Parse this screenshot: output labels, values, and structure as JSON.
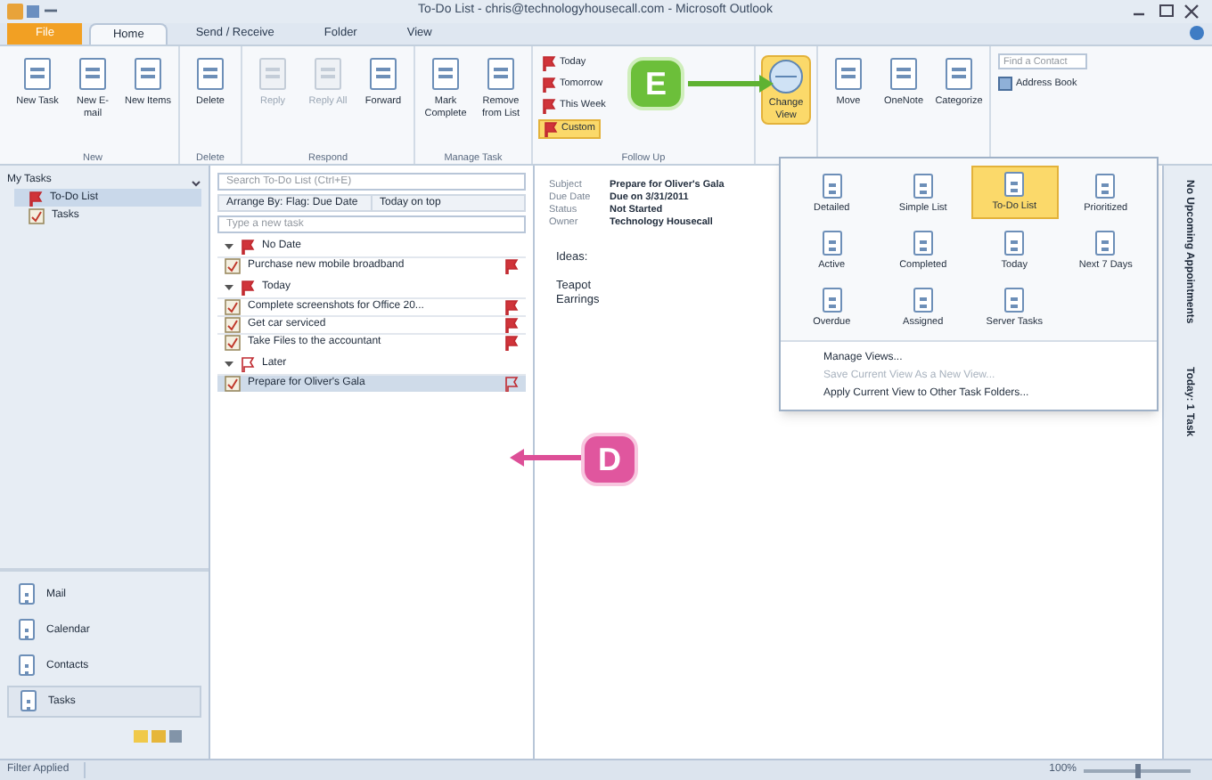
{
  "window": {
    "title": "To-Do List - chris@technologyhousecall.com - Microsoft Outlook"
  },
  "tabs": [
    {
      "label": "File",
      "selected": false,
      "kind": "file"
    },
    {
      "label": "Home",
      "selected": true,
      "kind": "tab"
    },
    {
      "label": "Send / Receive",
      "selected": false,
      "kind": "tab"
    },
    {
      "label": "Folder",
      "selected": false,
      "kind": "tab"
    },
    {
      "label": "View",
      "selected": false,
      "kind": "tab"
    }
  ],
  "ribbon": {
    "groups": [
      {
        "label": "New",
        "buttons": [
          {
            "label": "New Task",
            "disabled": false
          },
          {
            "label": "New E-mail",
            "disabled": false
          },
          {
            "label": "New Items",
            "disabled": false
          }
        ]
      },
      {
        "label": "Delete",
        "buttons": [
          {
            "label": "Delete",
            "disabled": false
          }
        ]
      },
      {
        "label": "Respond",
        "buttons": [
          {
            "label": "Reply",
            "disabled": true
          },
          {
            "label": "Reply All",
            "disabled": true
          },
          {
            "label": "Forward",
            "disabled": false
          }
        ]
      },
      {
        "label": "Manage Task",
        "buttons": [
          {
            "label": "Mark Complete",
            "disabled": false
          },
          {
            "label": "Remove from List",
            "disabled": false
          }
        ]
      },
      {
        "label": "Follow Up",
        "flags": [
          {
            "label": "Today",
            "selected": false
          },
          {
            "label": "Tomorrow",
            "selected": false
          },
          {
            "label": "This Week",
            "selected": false
          },
          {
            "label": "Custom",
            "selected": true
          }
        ]
      },
      {
        "buttons": [
          {
            "label": "Change View",
            "disabled": false
          }
        ]
      },
      {
        "buttons": [
          {
            "label": "Move",
            "disabled": false
          },
          {
            "label": "OneNote",
            "disabled": false
          },
          {
            "label": "Categorize",
            "disabled": false
          }
        ]
      }
    ],
    "find_contact": {
      "placeholder": "Find a Contact"
    },
    "address_book": "Address Book"
  },
  "nav": {
    "header": "My Tasks",
    "folders": [
      {
        "label": "To-Do List",
        "selected": true
      },
      {
        "label": "Tasks",
        "selected": false
      }
    ],
    "modules": [
      {
        "label": "Mail",
        "selected": false
      },
      {
        "label": "Calendar",
        "selected": false
      },
      {
        "label": "Contacts",
        "selected": false
      },
      {
        "label": "Tasks",
        "selected": true
      }
    ]
  },
  "task_list": {
    "search": {
      "placeholder": "Search To-Do List (Ctrl+E)"
    },
    "arrange_by": "Arrange By: Flag: Due Date",
    "order": "Today on top",
    "new_task": {
      "placeholder": "Type a new task"
    },
    "groups": [
      {
        "label": "No Date",
        "flagged": true,
        "tasks": [
          {
            "title": "Purchase new mobile broadband",
            "selected": false
          }
        ]
      },
      {
        "label": "Today",
        "flagged": true,
        "tasks": [
          {
            "title": "Complete screenshots for Office 20...",
            "selected": false
          },
          {
            "title": "Get car serviced",
            "selected": false
          },
          {
            "title": "Take Files to the accountant",
            "selected": false
          }
        ]
      },
      {
        "label": "Later",
        "flagged": false,
        "tasks": [
          {
            "title": "Prepare for Oliver's Gala",
            "selected": true
          }
        ]
      }
    ]
  },
  "reading_pane": {
    "fields": [
      {
        "label": "Subject",
        "value": "Prepare for Oliver's Gala"
      },
      {
        "label": "Due Date",
        "value": "Due on 3/31/2011"
      },
      {
        "label": "Status",
        "value": "Not Started"
      },
      {
        "label": "Owner",
        "value": "Technology Housecall"
      }
    ],
    "body": [
      {
        "lines": [
          "Ideas:"
        ]
      },
      {
        "lines": [
          "Teapot",
          "Earrings"
        ]
      }
    ]
  },
  "view_gallery": {
    "views": [
      {
        "label": "Detailed",
        "selected": false
      },
      {
        "label": "Simple List",
        "selected": false
      },
      {
        "label": "To-Do List",
        "selected": true
      },
      {
        "label": "Prioritized",
        "selected": false
      },
      {
        "label": "Active",
        "selected": false
      },
      {
        "label": "Completed",
        "selected": false
      },
      {
        "label": "Today",
        "selected": false
      },
      {
        "label": "Next 7 Days",
        "selected": false
      },
      {
        "label": "Overdue",
        "selected": false
      },
      {
        "label": "Assigned",
        "selected": false
      },
      {
        "label": "Server Tasks",
        "selected": false
      }
    ],
    "commands": [
      {
        "label": "Manage Views...",
        "disabled": false
      },
      {
        "label": "Save Current View As a New View...",
        "disabled": true
      },
      {
        "label": "Apply Current View to Other Task Folders...",
        "disabled": false
      }
    ]
  },
  "todo_bar": {
    "sections": [
      "No Upcoming Appointments",
      "Today: 1 Task"
    ]
  },
  "status_bar": {
    "left": "Filter Applied",
    "zoom": "100%",
    "zoom_slider": {
      "level": 0.5
    }
  },
  "callouts": [
    {
      "label": "E",
      "kind": "green"
    },
    {
      "label": "D",
      "kind": "pink"
    }
  ]
}
